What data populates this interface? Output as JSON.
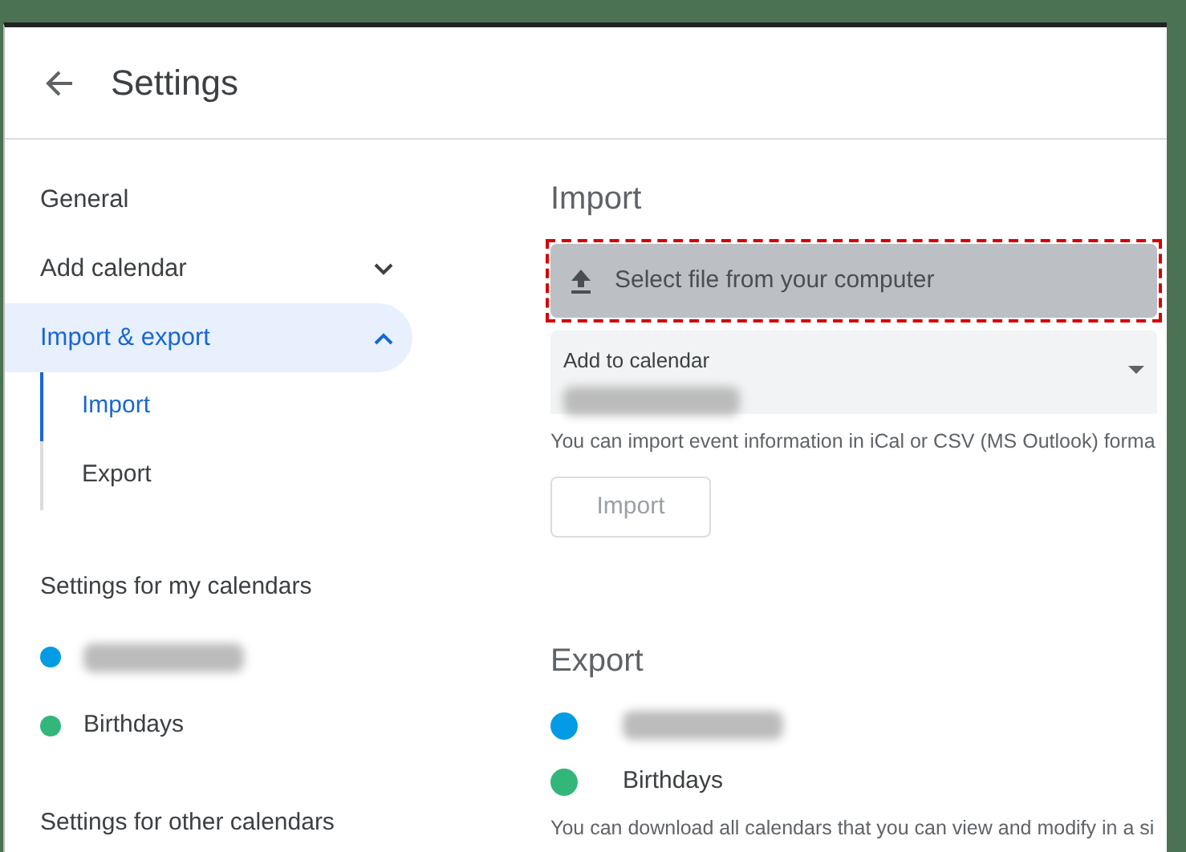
{
  "header": {
    "title": "Settings"
  },
  "sidebar": {
    "items": [
      {
        "label": "General",
        "selected": false
      },
      {
        "label": "Add calendar",
        "selected": false,
        "expanded": false
      },
      {
        "label": "Import & export",
        "selected": true,
        "expanded": true,
        "children": [
          {
            "label": "Import",
            "selected": true
          },
          {
            "label": "Export",
            "selected": false
          }
        ]
      }
    ],
    "sections": [
      {
        "title": "Settings for my calendars",
        "calendars": [
          {
            "blurred": true,
            "color": "#039be5"
          },
          {
            "label": "Birthdays",
            "blurred": false,
            "color": "#33b679"
          }
        ]
      },
      {
        "title": "Settings for other calendars"
      }
    ]
  },
  "import": {
    "title": "Import",
    "file_button": "Select file from your computer",
    "highlighted": true,
    "calendar_select": {
      "label": "Add to calendar",
      "blurred": true
    },
    "help": "You can import event information in iCal or CSV (MS Outlook) forma",
    "import_button": "Import"
  },
  "export": {
    "title": "Export",
    "calendars": [
      {
        "blurred": true,
        "color": "#039be5"
      },
      {
        "label": "Birthdays",
        "blurred": false,
        "color": "#33b679"
      }
    ],
    "help": "You can download all calendars that you can view and modify in a si"
  }
}
